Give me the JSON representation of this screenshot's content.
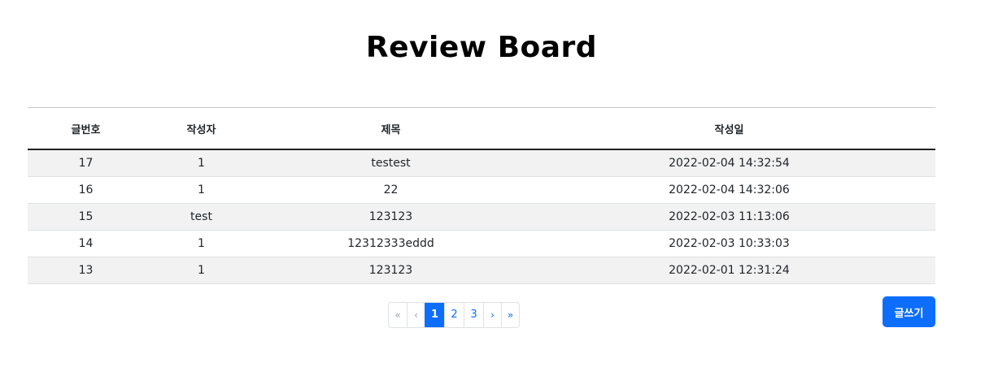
{
  "page": {
    "title": "Review Board"
  },
  "table": {
    "headers": {
      "no": "글번호",
      "writer": "작성자",
      "subject": "제목",
      "date": "작성일"
    },
    "rows": [
      {
        "no": "17",
        "writer": "1",
        "subject": "testest",
        "date": "2022-02-04 14:32:54"
      },
      {
        "no": "16",
        "writer": "1",
        "subject": "22",
        "date": "2022-02-04 14:32:06"
      },
      {
        "no": "15",
        "writer": "test",
        "subject": "123123",
        "date": "2022-02-03 11:13:06"
      },
      {
        "no": "14",
        "writer": "1",
        "subject": "12312333eddd",
        "date": "2022-02-03 10:33:03"
      },
      {
        "no": "13",
        "writer": "1",
        "subject": "123123",
        "date": "2022-02-01 12:31:24"
      }
    ]
  },
  "pagination": {
    "first": "«",
    "prev": "‹",
    "pages": [
      "1",
      "2",
      "3"
    ],
    "active_page": "1",
    "next": "›",
    "last": "»"
  },
  "actions": {
    "write_label": "글쓰기"
  },
  "colors": {
    "primary": "#0d6efd",
    "row_stripe": "#f2f2f2"
  }
}
